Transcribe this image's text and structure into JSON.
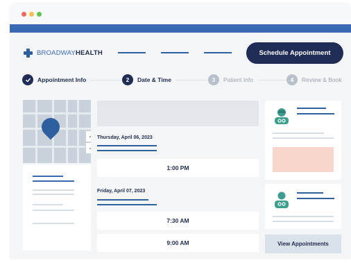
{
  "window": {
    "dots": [
      {
        "name": "close-dot",
        "color": "#ed6a5e"
      },
      {
        "name": "minimize-dot",
        "color": "#f5bf4f"
      },
      {
        "name": "maximize-dot",
        "color": "#61c554"
      }
    ]
  },
  "brand": {
    "prefix": "BROADWAY",
    "suffix": "HEALTH",
    "accent_color": "#3b68b3",
    "dark_color": "#1f2d56"
  },
  "header": {
    "schedule_label": "Schedule Appointment"
  },
  "steps": [
    {
      "number": "",
      "label": "Appointment Info",
      "state": "completed",
      "icon": "check-icon"
    },
    {
      "number": "2",
      "label": "Date & Time",
      "state": "active"
    },
    {
      "number": "3",
      "label": "Patient Info",
      "state": "pending"
    },
    {
      "number": "4",
      "label": "Review & Book",
      "state": "pending"
    }
  ],
  "map": {
    "zoom_in": "+",
    "zoom_out": "−",
    "pin_icon": "location-pin-icon"
  },
  "dates": [
    {
      "label": "Thursday, April 06, 2023",
      "slots": [
        "1:00 PM"
      ]
    },
    {
      "label": "Friday, April 07, 2023",
      "slots": [
        "7:30 AM",
        "9:00 AM"
      ]
    }
  ],
  "doctors": [
    {
      "icon": "doctor-female-icon",
      "highlight_color": "#f9d6cc"
    },
    {
      "icon": "doctor-male-icon"
    }
  ],
  "sidebar": {
    "view_appointments_label": "View Appointments"
  }
}
